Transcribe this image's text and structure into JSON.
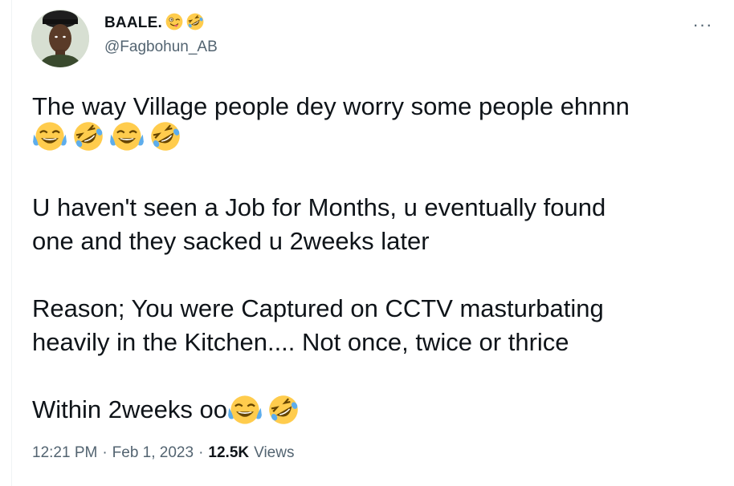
{
  "author": {
    "display_name": "BAALE.",
    "handle": "@Fagbohun_AB",
    "name_emojis": [
      "winking-tongue-emoji",
      "rofl-emoji"
    ]
  },
  "more_menu": {
    "icon": "more-horizontal-icon",
    "label": "···"
  },
  "tweet": {
    "line1": "The way Village people dey worry some people ehnnn",
    "line1_emojis": [
      "tears-of-joy-emoji",
      "rofl-emoji",
      "tears-of-joy-emoji",
      "rofl-emoji"
    ],
    "para2_line1": "U haven't seen a Job for Months, u eventually found",
    "para2_line2": "one and they sacked u 2weeks later",
    "para3_line1": "Reason; You were Captured on CCTV masturbating",
    "para3_line2": "heavily in the Kitchen.... Not once, twice or thrice",
    "para4": "Within 2weeks oo",
    "para4_emojis": [
      "tears-of-joy-emoji",
      "rofl-emoji"
    ]
  },
  "meta": {
    "time": "12:21 PM",
    "separator": "·",
    "date": "Feb 1, 2023",
    "views_count": "12.5K",
    "views_label": "Views"
  },
  "colors": {
    "text_primary": "#0f1419",
    "text_secondary": "#536471",
    "emoji_yellow": "#ffcc4d",
    "emoji_tear": "#5dadec"
  }
}
